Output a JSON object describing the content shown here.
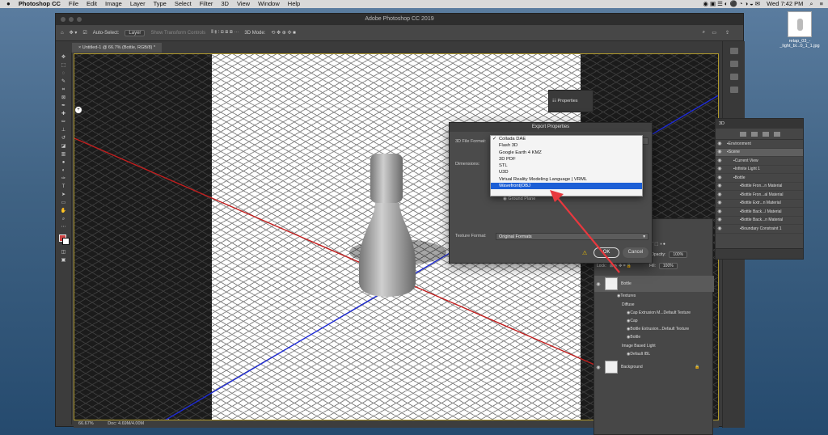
{
  "menubar": {
    "apple": "",
    "app_name": "Photoshop CC",
    "items": [
      "File",
      "Edit",
      "Image",
      "Layer",
      "Type",
      "Select",
      "Filter",
      "3D",
      "View",
      "Window",
      "Help"
    ],
    "clock": "Wed 7:42 PM"
  },
  "window": {
    "title": "Adobe Photoshop CC 2019",
    "doc_tab": "Untitled-1 @ 66.7% (Bottle, RGB/8) *"
  },
  "options_bar": {
    "auto_select_label": "Auto-Select:",
    "auto_select_value": "Layer",
    "show_transform": "Show Transform Controls",
    "mode_3d": "3D Mode:"
  },
  "status": {
    "zoom": "66.67%",
    "doc": "Doc: 4.69M/4.00M"
  },
  "properties_panel": {
    "title": "Properties"
  },
  "panel_3d": {
    "title": "3D",
    "rows": [
      {
        "label": "Environment",
        "indent": 0,
        "selected": false
      },
      {
        "label": "Scene",
        "indent": 0,
        "selected": true
      },
      {
        "label": "Current View",
        "indent": 1,
        "selected": false
      },
      {
        "label": "Infinite Light 1",
        "indent": 1,
        "selected": false
      },
      {
        "label": "Bottle",
        "indent": 1,
        "selected": false
      },
      {
        "label": "Bottle Fron...n Material",
        "indent": 2,
        "selected": false
      },
      {
        "label": "Bottle Fron...al Material",
        "indent": 2,
        "selected": false
      },
      {
        "label": "Bottle Extr...n Material",
        "indent": 2,
        "selected": false
      },
      {
        "label": "Bottle Back...l Material",
        "indent": 2,
        "selected": false
      },
      {
        "label": "Bottle Back...n Material",
        "indent": 2,
        "selected": false
      },
      {
        "label": "Boundary Constraint 1",
        "indent": 2,
        "selected": false
      }
    ]
  },
  "layers_panel": {
    "opacity_label": "Opacity:",
    "opacity_value": "100%",
    "lock_label": "Lock:",
    "fill_label": "Fill:",
    "fill_value": "100%",
    "bottle": "Bottle",
    "textures": "Textures",
    "diffuse": "Diffuse",
    "tex1": "Cap Extrusion M...Default Texture",
    "tex2": "Cap",
    "tex3": "Bottle Extrusion...Default Texture",
    "tex4": "Bottle",
    "ibl": "Image Based Light",
    "default_ibl": "Default IBL",
    "background": "Background"
  },
  "export_dialog": {
    "title": "Export Properties",
    "format_label": "3D File Format:",
    "dimensions_label": "Dimensions:",
    "ground_plane": "Ground Plane",
    "texture_label": "Texture Format:",
    "texture_value": "Original Formats",
    "ok": "OK",
    "cancel": "Cancel"
  },
  "format_dropdown": {
    "options": [
      "Collada DAE",
      "Flash 3D",
      "Google Earth 4 KMZ",
      "3D PDF",
      "STL",
      "U3D",
      "Virtual Reality Modeling Language | VRML",
      "Wavefront|OBJ"
    ],
    "checked_index": 0,
    "highlighted_index": 7
  },
  "desktop_file": {
    "name": "retap_03_-_light_bl...0_1_1.jpg"
  },
  "colors": {
    "accent_blue": "#1c5fd6",
    "arrow_red": "#e8383e",
    "grid_axis_blue": "#1e2bd6",
    "grid_axis_red": "#c21e1e"
  }
}
